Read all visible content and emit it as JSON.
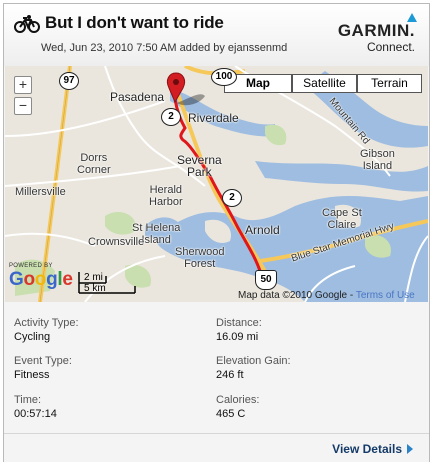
{
  "activity": {
    "title": "But I don't want to ride",
    "subtitle": "Wed, Jun 23, 2010 7:50 AM added by ejanssenmd",
    "icon": "bicycle-icon"
  },
  "brand": {
    "name": "GARMIN.",
    "sub": "Connect."
  },
  "map": {
    "types": [
      {
        "label": "Map",
        "active": true
      },
      {
        "label": "Satellite",
        "active": false
      },
      {
        "label": "Terrain",
        "active": false
      }
    ],
    "zoom_in": "+",
    "zoom_out": "−",
    "places": {
      "pasadena": "Pasadena",
      "riverdale": "Riverdale",
      "severna_park": "Severna\nPark",
      "dorrs_corner": "Dorrs\nCorner",
      "millersville": "Millersville",
      "herald_harbor": "Herald\nHarbor",
      "st_helena": "St Helena\nIsland",
      "crownsville": "Crownsville",
      "sherwood": "Sherwood\nForest",
      "arnold": "Arnold",
      "cape_st_claire": "Cape St\nClaire",
      "gibson_island": "Gibson\nIsland",
      "blue_star": "Blue Star Memorial Hwy",
      "mountain_rd": "Mountain Rd"
    },
    "route_shields": {
      "r97": "97",
      "r100": "100",
      "r2a": "2",
      "r2b": "2",
      "r2c": "2",
      "us50": "50"
    },
    "scale": {
      "mi": "2 mi",
      "km": "5 km"
    },
    "powered_by": "POWERED BY",
    "google": "Google",
    "copyright": "Map data ©2010 Google - ",
    "terms": "Terms of Use",
    "colors": {
      "route": "#e0161b",
      "water": "#9ebde0",
      "land": "#eae6dd",
      "park": "#c9dfaf",
      "highway": "#f6c85a"
    }
  },
  "stats": {
    "activity_type": {
      "label": "Activity Type:",
      "value": "Cycling"
    },
    "distance": {
      "label": "Distance:",
      "value": "16.09 mi"
    },
    "event_type": {
      "label": "Event Type:",
      "value": "Fitness"
    },
    "elevation_gain": {
      "label": "Elevation Gain:",
      "value": "246 ft"
    },
    "time": {
      "label": "Time:",
      "value": "00:57:14"
    },
    "calories": {
      "label": "Calories:",
      "value": "465 C"
    }
  },
  "footer": {
    "view_details": "View Details"
  }
}
